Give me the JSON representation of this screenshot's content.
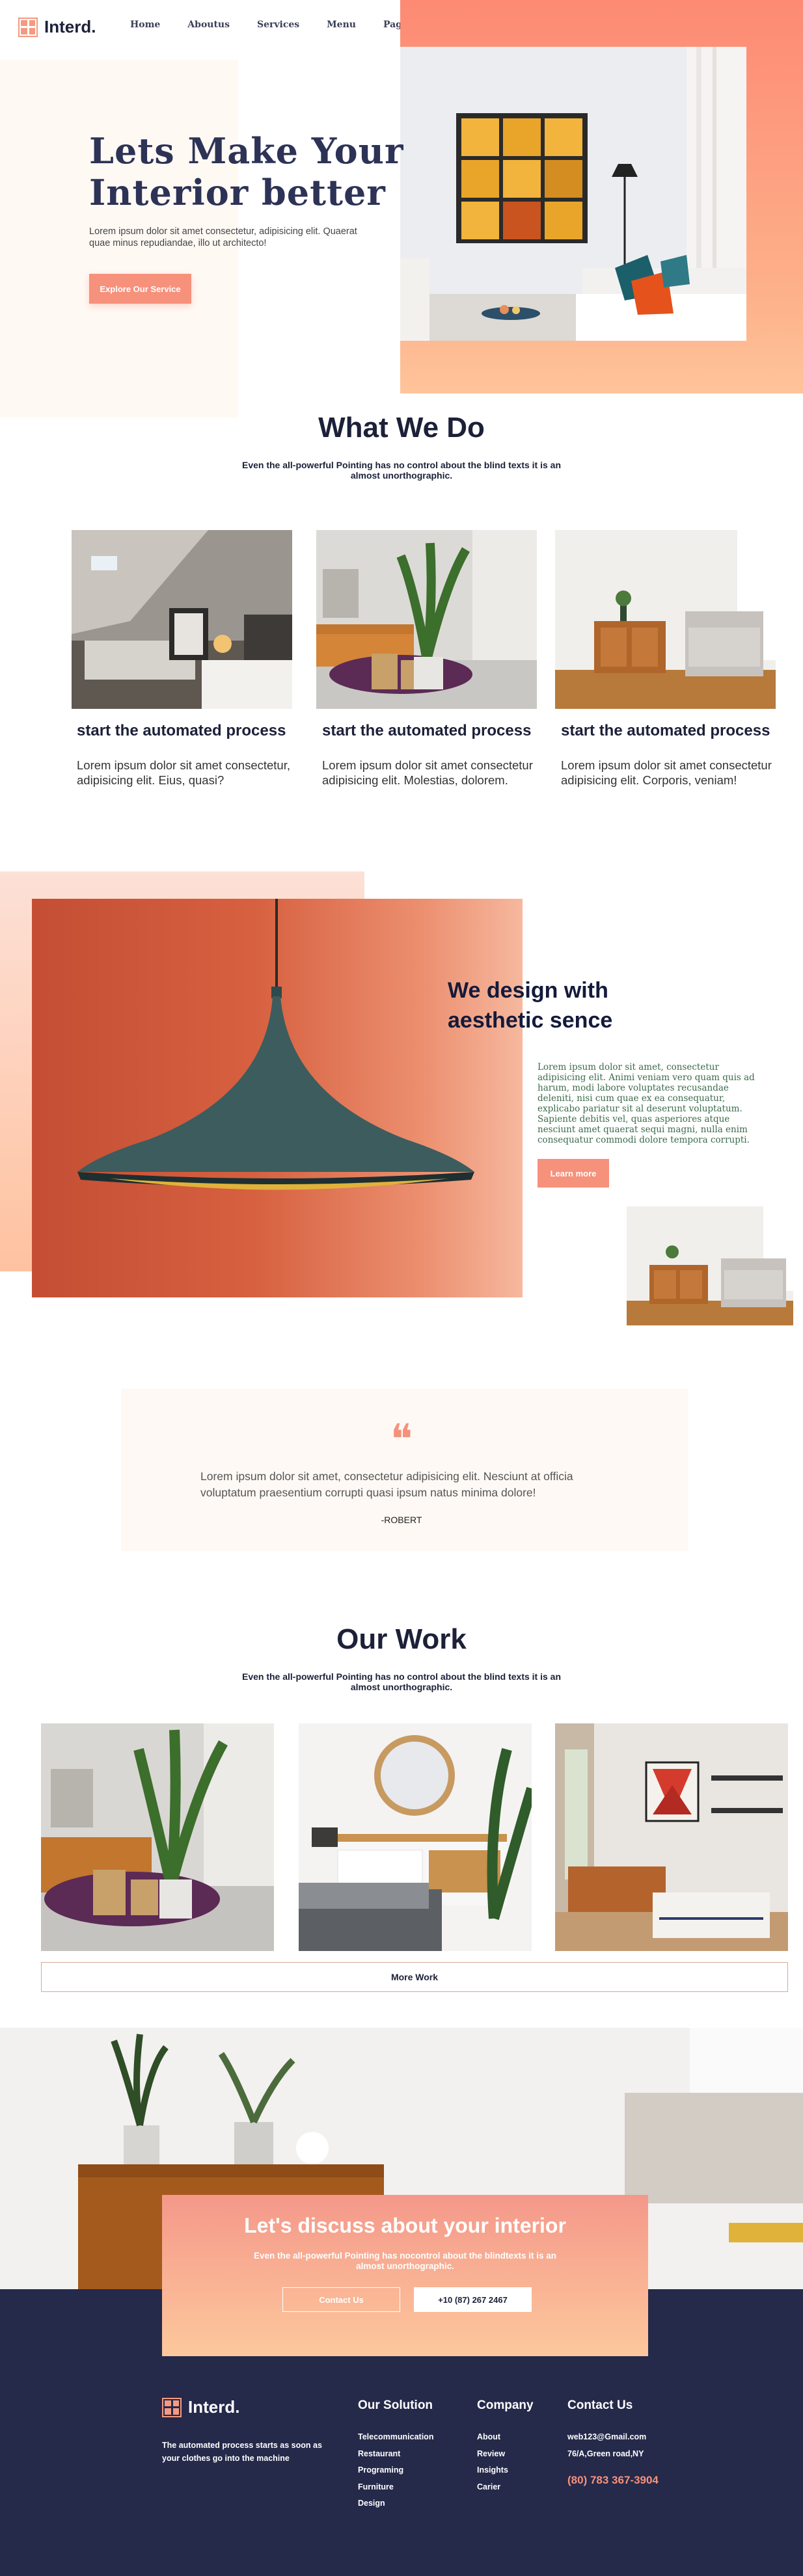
{
  "brand": {
    "name": "Interd.",
    "accent": "#f6917c",
    "dark": "#25294a"
  },
  "nav": {
    "items": [
      "Home",
      "Aboutus",
      "Services",
      "Menu",
      "Pages"
    ]
  },
  "hero": {
    "title_line1": "Lets Make Your",
    "title_line2": "Interior better",
    "text": "Lorem ipsum dolor sit amet consectetur, adipisicing elit. Quaerat quae minus repudiandae, illo ut architecto!",
    "button": "Explore Our Service"
  },
  "what_we_do": {
    "title": "What We Do",
    "subtitle": "Even the all-powerful Pointing has no control about the blind texts it is an almost unorthographic.",
    "cards": [
      {
        "title": "start the automated process",
        "text": "Lorem ipsum dolor sit amet consectetur, adipisicing elit. Eius, quasi?"
      },
      {
        "title": "start the automated process",
        "text": "Lorem ipsum dolor sit amet consectetur adipisicing elit. Molestias, dolorem."
      },
      {
        "title": "start the automated process",
        "text": "Lorem ipsum dolor sit amet consectetur adipisicing elit. Corporis, veniam!"
      }
    ]
  },
  "design": {
    "title_line1": "We design with",
    "title_line2": "aesthetic sence",
    "text": "Lorem ipsum dolor sit amet, consectetur adipisicing elit. Animi veniam vero quam quis ad harum, modi labore voluptates recusandae deleniti, nisi cum quae ex ea consequatur, explicabo pariatur sit al deserunt voluptatum. Sapiente debitis vel, quas asperiores atque nesciunt amet quaerat sequi magni, nulla enim consequatur commodi dolore tempora corrupti.",
    "button": "Learn more"
  },
  "quote": {
    "mark": "❝",
    "text": "Lorem ipsum dolor sit amet, consectetur adipisicing elit. Nesciunt at officia voluptatum praesentium corrupti quasi ipsum natus minima dolore!",
    "author": "-ROBERT"
  },
  "our_work": {
    "title": "Our Work",
    "subtitle": "Even the all-powerful Pointing has no control about the blind texts it is an almost unorthographic.",
    "button": "More Work"
  },
  "discuss": {
    "title": "Let's discuss about your interior",
    "subtitle": "Even the all-powerful Pointing has nocontrol about the blindtexts it is an almost unorthographic.",
    "contact_button": "Contact Us",
    "phone_button": "+10 (87) 267 2467"
  },
  "footer": {
    "tagline": "The automated process starts as soon as your clothes go into the machine",
    "solution": {
      "title": "Our Solution",
      "items": [
        "Telecommunication",
        "Restaurant",
        "Programing",
        "Furniture",
        "Design"
      ]
    },
    "company": {
      "title": "Company",
      "items": [
        "About",
        "Review",
        "Insights",
        "Carier"
      ]
    },
    "contact": {
      "title": "Contact Us",
      "email": "web123@Gmail.com",
      "address": "76/A,Green road,NY",
      "phone": "(80) 783 367-3904"
    }
  }
}
